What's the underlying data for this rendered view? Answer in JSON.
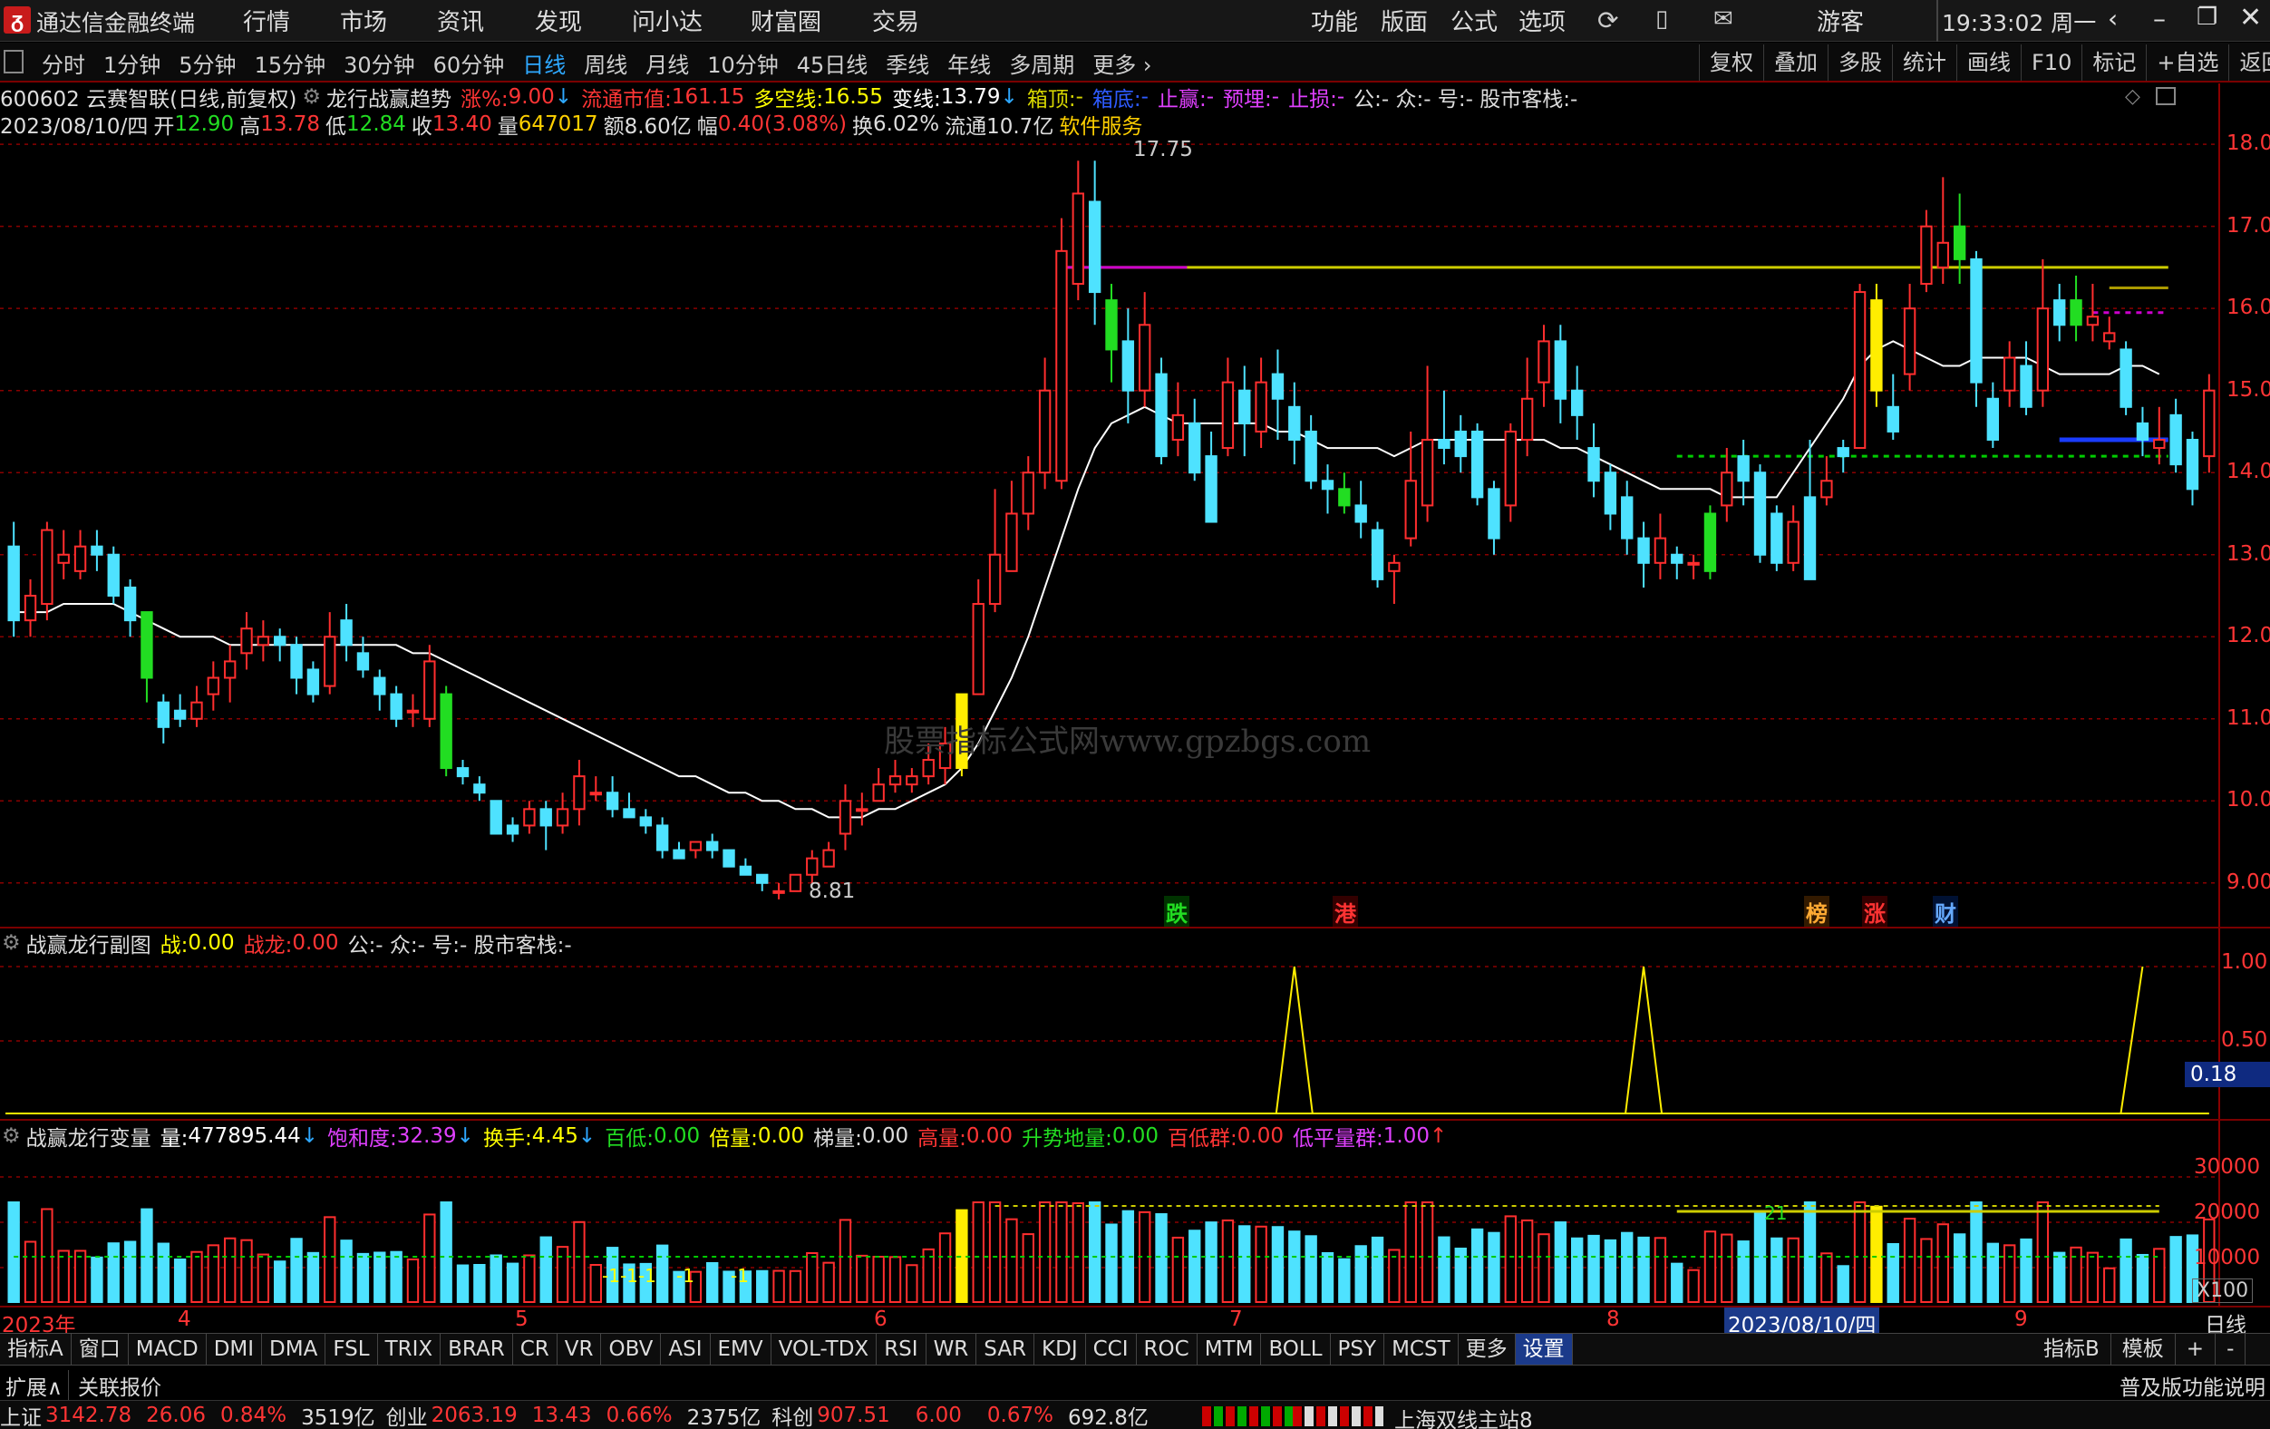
{
  "app": {
    "title": "通达信金融终端",
    "clock": "19:33:02 周一",
    "user": "游客",
    "menu": [
      "行情",
      "市场",
      "资讯",
      "发现",
      "问小达",
      "财富圈",
      "交易"
    ],
    "menu_right": [
      "功能",
      "版面",
      "公式",
      "选项"
    ]
  },
  "periods": {
    "items": [
      "分时",
      "1分钟",
      "5分钟",
      "15分钟",
      "30分钟",
      "60分钟",
      "日线",
      "周线",
      "月线",
      "10分钟",
      "45日线",
      "季线",
      "年线",
      "多周期",
      "更多"
    ],
    "active": "日线"
  },
  "toolbar": [
    "复权",
    "叠加",
    "多股",
    "统计",
    "画线",
    "F10",
    "标记",
    "+自选",
    "返回"
  ],
  "main": {
    "title": {
      "code": "600602 云赛智联(日线,前复权)",
      "indicator": "龙行战赢趋势",
      "zf_label": "涨%:",
      "zf": "9.00",
      "ltsz_label": "流通市值:",
      "ltsz": "161.15",
      "dkx_label": "多空线:",
      "dkx": "16.55",
      "bx_label": "变线:",
      "bx": "13.79",
      "xd_label": "箱顶:",
      "xd": "-",
      "xdi_label": "箱底:",
      "xdi": "-",
      "zy_label": "止赢:",
      "zy": "-",
      "ym_label": "预埋:",
      "ym": "-",
      "zs_label": "止损:",
      "zs": "-",
      "gzh": "公:- 众:- 号:- 股市客栈:-"
    },
    "ohlc": {
      "date": "2023/08/10/四",
      "open_label": "开",
      "open": "12.90",
      "high_label": "高",
      "high": "13.78",
      "low_label": "低",
      "low": "12.84",
      "close_label": "收",
      "close": "13.40",
      "vol_label": "量",
      "vol": "647017",
      "amt_label": "额",
      "amt": "8.60亿",
      "amp_label": "幅",
      "amp": "0.40(3.08%)",
      "turn_label": "换",
      "turn": "6.02%",
      "float_label": "流通",
      "float": "10.7亿",
      "service": "软件服务"
    },
    "annotations": {
      "high": "17.75",
      "low": "8.81",
      "watermark": "股票指标公式网www.gpzbgs.com"
    },
    "markers": [
      {
        "text": "跌",
        "color": "#22dd22",
        "bg": "#003300"
      },
      {
        "text": "港",
        "color": "#ff3333",
        "bg": "#330000"
      },
      {
        "text": "榜",
        "color": "#ffaa33",
        "bg": "#331a00"
      },
      {
        "text": "涨",
        "color": "#ff3333",
        "bg": "#330000"
      },
      {
        "text": "财",
        "color": "#66aaff",
        "bg": "#001133"
      }
    ],
    "y_ticks": [
      "18.00",
      "17.00",
      "16.00",
      "15.00",
      "14.00",
      "13.00",
      "12.00",
      "11.00",
      "10.00",
      "9.00"
    ]
  },
  "sub1": {
    "name": "战赢龙行副图",
    "zhan_label": "战:",
    "zhan": "0.00",
    "zhanlong_label": "战龙:",
    "zhanlong": "0.00",
    "gzh": "公:- 众:- 号:- 股市客栈:-",
    "y_ticks": [
      "1.00",
      "0.50"
    ],
    "current": "0.18"
  },
  "sub2": {
    "name": "战赢龙行变量",
    "vol_label": "量:",
    "vol": "477895.44",
    "bhd_label": "饱和度:",
    "bhd": "32.39",
    "hs_label": "换手:",
    "hs": "4.45",
    "bd_label": "百低:",
    "bd": "0.00",
    "bl_label": "倍量:",
    "bl": "0.00",
    "tl_label": "梯量:",
    "tl": "0.00",
    "gl_label": "高量:",
    "gl": "0.00",
    "ssdl_label": "升势地量:",
    "ssdl": "0.00",
    "bdq_label": "百低群:",
    "bdq": "0.00",
    "dpl_label": "低平量群:",
    "dpl": "1.00",
    "y_ticks": [
      "30000",
      "20000",
      "10000"
    ],
    "unit": "X100",
    "labels": {
      "d1": "21",
      "s1": "-1-1-1",
      "s2": "-1",
      "s3": "-1"
    }
  },
  "xaxis": {
    "labels": [
      "2023年",
      "4",
      "5",
      "6",
      "7",
      "8",
      "9"
    ],
    "cursor": "2023/08/10/四",
    "right": "日线"
  },
  "tabs": {
    "left": [
      "指标A",
      "窗口",
      "MACD",
      "DMI",
      "DMA",
      "FSL",
      "TRIX",
      "BRAR",
      "CR",
      "VR",
      "OBV",
      "ASI",
      "EMV",
      "VOL-TDX",
      "RSI",
      "WR",
      "SAR",
      "KDJ",
      "CCI",
      "ROC",
      "MTM",
      "BOLL",
      "PSY",
      "MCST",
      "更多",
      "设置"
    ],
    "right": [
      "指标B",
      "模板",
      "+",
      "-"
    ]
  },
  "bottom": {
    "left": [
      "扩展∧",
      "关联报价"
    ],
    "right": "普及版功能说明"
  },
  "status": {
    "sh_label": "上证",
    "sh": "3142.78",
    "sh_chg": "26.06",
    "sh_pct": "0.84%",
    "sh_amt": "3519亿",
    "cy_label": "创业",
    "cy": "2063.19",
    "cy_chg": "13.43",
    "cy_pct": "0.66%",
    "cy_amt": "2375亿",
    "kc_label": "科创",
    "kc": "907.51",
    "kc_chg": "6.00",
    "kc_pct": "0.67%",
    "kc_amt": "692.8亿",
    "server": "上海双线主站8"
  },
  "chart_data": {
    "type": "candlestick",
    "ylim": [
      8.6,
      18.3
    ],
    "candles": [
      [
        13.1,
        12.2,
        13.4,
        12.0
      ],
      [
        12.2,
        12.5,
        12.7,
        12.0
      ],
      [
        12.4,
        13.3,
        13.4,
        12.2
      ],
      [
        12.9,
        13.0,
        13.3,
        12.7
      ],
      [
        12.8,
        13.1,
        13.3,
        12.7
      ],
      [
        13.1,
        13.0,
        13.3,
        12.8
      ],
      [
        13.0,
        12.5,
        13.1,
        12.4
      ],
      [
        12.6,
        12.2,
        12.7,
        12.0
      ],
      [
        12.3,
        11.5,
        12.3,
        11.2
      ],
      [
        11.2,
        10.9,
        11.3,
        10.7
      ],
      [
        11.1,
        11.0,
        11.3,
        10.9
      ],
      [
        11.0,
        11.2,
        11.4,
        10.9
      ],
      [
        11.3,
        11.5,
        11.7,
        11.1
      ],
      [
        11.5,
        11.7,
        11.9,
        11.2
      ],
      [
        11.8,
        12.1,
        12.3,
        11.6
      ],
      [
        11.9,
        12.0,
        12.2,
        11.7
      ],
      [
        12.0,
        11.9,
        12.1,
        11.7
      ],
      [
        11.9,
        11.5,
        12.0,
        11.3
      ],
      [
        11.6,
        11.3,
        11.7,
        11.2
      ],
      [
        11.4,
        12.0,
        12.3,
        11.3
      ],
      [
        12.2,
        11.9,
        12.4,
        11.7
      ],
      [
        11.8,
        11.6,
        12.0,
        11.5
      ],
      [
        11.5,
        11.3,
        11.6,
        11.1
      ],
      [
        11.3,
        11.0,
        11.4,
        10.9
      ],
      [
        11.1,
        11.1,
        11.3,
        10.9
      ],
      [
        11.0,
        11.7,
        11.9,
        10.9
      ],
      [
        11.3,
        10.4,
        11.4,
        10.3
      ],
      [
        10.4,
        10.3,
        10.5,
        10.2
      ],
      [
        10.2,
        10.1,
        10.3,
        10.0
      ],
      [
        10.0,
        9.6,
        10.0,
        9.6
      ],
      [
        9.7,
        9.6,
        9.8,
        9.5
      ],
      [
        9.7,
        9.9,
        10.0,
        9.6
      ],
      [
        9.9,
        9.7,
        10.0,
        9.4
      ],
      [
        9.7,
        9.9,
        10.1,
        9.6
      ],
      [
        9.9,
        10.3,
        10.5,
        9.7
      ],
      [
        10.1,
        10.1,
        10.3,
        10.0
      ],
      [
        10.1,
        9.9,
        10.3,
        9.8
      ],
      [
        9.9,
        9.8,
        10.1,
        9.8
      ],
      [
        9.8,
        9.7,
        9.9,
        9.6
      ],
      [
        9.7,
        9.4,
        9.8,
        9.3
      ],
      [
        9.4,
        9.3,
        9.5,
        9.3
      ],
      [
        9.4,
        9.5,
        9.5,
        9.3
      ],
      [
        9.5,
        9.4,
        9.6,
        9.3
      ],
      [
        9.4,
        9.2,
        9.4,
        9.2
      ],
      [
        9.2,
        9.1,
        9.3,
        9.1
      ],
      [
        9.1,
        9.0,
        9.1,
        8.9
      ],
      [
        8.9,
        8.9,
        9.0,
        8.8
      ],
      [
        8.9,
        9.1,
        9.1,
        8.9
      ],
      [
        9.1,
        9.3,
        9.4,
        9.0
      ],
      [
        9.2,
        9.4,
        9.5,
        9.2
      ],
      [
        9.6,
        10.0,
        10.2,
        9.4
      ],
      [
        9.9,
        9.9,
        10.1,
        9.7
      ],
      [
        10.0,
        10.2,
        10.4,
        10.0
      ],
      [
        10.2,
        10.3,
        10.5,
        10.1
      ],
      [
        10.2,
        10.3,
        10.4,
        10.1
      ],
      [
        10.3,
        10.5,
        10.7,
        10.2
      ],
      [
        10.4,
        10.7,
        10.9,
        10.2
      ],
      [
        10.4,
        11.3,
        11.3,
        10.3
      ],
      [
        11.3,
        12.4,
        12.7,
        11.3
      ],
      [
        12.4,
        13.0,
        13.8,
        12.3
      ],
      [
        12.8,
        13.5,
        13.9,
        12.8
      ],
      [
        13.5,
        14.0,
        14.2,
        13.3
      ],
      [
        14.0,
        15.0,
        15.4,
        13.8
      ],
      [
        13.9,
        16.7,
        17.1,
        13.8
      ],
      [
        16.3,
        17.4,
        17.8,
        16.1
      ],
      [
        17.3,
        16.2,
        17.8,
        15.8
      ],
      [
        16.1,
        15.5,
        16.3,
        15.1
      ],
      [
        15.6,
        15.0,
        16.0,
        14.6
      ],
      [
        15.0,
        15.8,
        16.2,
        14.8
      ],
      [
        15.2,
        14.2,
        15.4,
        14.1
      ],
      [
        14.4,
        14.7,
        15.1,
        14.2
      ],
      [
        14.6,
        14.0,
        14.9,
        13.9
      ],
      [
        14.2,
        13.4,
        14.5,
        13.4
      ],
      [
        14.3,
        15.1,
        15.4,
        14.2
      ],
      [
        15.0,
        14.6,
        15.3,
        14.2
      ],
      [
        14.5,
        15.1,
        15.4,
        14.3
      ],
      [
        15.2,
        14.9,
        15.5,
        14.4
      ],
      [
        14.8,
        14.4,
        15.1,
        14.1
      ],
      [
        14.5,
        13.9,
        14.7,
        13.8
      ],
      [
        13.9,
        13.8,
        14.1,
        13.5
      ],
      [
        13.8,
        13.6,
        14.0,
        13.5
      ],
      [
        13.6,
        13.4,
        13.9,
        13.2
      ],
      [
        13.3,
        12.7,
        13.4,
        12.6
      ],
      [
        12.8,
        12.9,
        13.0,
        12.4
      ],
      [
        13.2,
        13.9,
        14.5,
        13.1
      ],
      [
        13.6,
        14.4,
        15.3,
        13.4
      ],
      [
        14.4,
        14.3,
        15.0,
        14.1
      ],
      [
        14.5,
        14.2,
        14.7,
        14.0
      ],
      [
        14.5,
        13.7,
        14.6,
        13.6
      ],
      [
        13.8,
        13.2,
        13.9,
        13.0
      ],
      [
        13.6,
        14.5,
        14.6,
        13.4
      ],
      [
        14.4,
        14.9,
        15.4,
        14.2
      ],
      [
        15.1,
        15.6,
        15.8,
        14.8
      ],
      [
        15.6,
        14.9,
        15.8,
        14.6
      ],
      [
        15.0,
        14.7,
        15.3,
        14.4
      ],
      [
        14.3,
        13.9,
        14.6,
        13.7
      ],
      [
        14.0,
        13.5,
        14.1,
        13.3
      ],
      [
        13.7,
        13.2,
        13.9,
        13.0
      ],
      [
        13.2,
        12.9,
        13.4,
        12.6
      ],
      [
        12.9,
        13.2,
        13.5,
        12.7
      ],
      [
        13.0,
        12.9,
        13.1,
        12.7
      ],
      [
        12.9,
        12.9,
        13.0,
        12.7
      ],
      [
        12.8,
        13.5,
        13.6,
        12.7
      ],
      [
        13.6,
        14.0,
        14.3,
        13.4
      ],
      [
        14.2,
        13.9,
        14.4,
        13.6
      ],
      [
        14.0,
        13.0,
        14.1,
        12.9
      ],
      [
        13.5,
        12.9,
        13.6,
        12.8
      ],
      [
        12.9,
        13.4,
        13.6,
        12.8
      ],
      [
        13.7,
        12.7,
        14.4,
        12.7
      ],
      [
        13.7,
        13.9,
        14.2,
        13.6
      ],
      [
        14.3,
        14.2,
        14.4,
        14.0
      ],
      [
        14.3,
        16.2,
        16.3,
        14.3
      ],
      [
        16.1,
        15.0,
        16.3,
        14.8
      ],
      [
        14.8,
        14.5,
        15.2,
        14.4
      ],
      [
        15.2,
        16.0,
        16.3,
        15.0
      ],
      [
        16.3,
        17.0,
        17.2,
        16.2
      ],
      [
        16.5,
        16.8,
        17.6,
        16.3
      ],
      [
        17.0,
        16.6,
        17.4,
        16.3
      ],
      [
        16.6,
        15.1,
        16.7,
        14.8
      ],
      [
        14.9,
        14.4,
        15.1,
        14.3
      ],
      [
        15.0,
        15.4,
        15.6,
        14.8
      ],
      [
        15.3,
        14.8,
        15.6,
        14.7
      ],
      [
        15.0,
        16.0,
        16.6,
        14.8
      ],
      [
        16.1,
        15.8,
        16.3,
        15.6
      ],
      [
        15.8,
        16.1,
        16.4,
        15.6
      ],
      [
        15.8,
        15.9,
        16.3,
        15.6
      ],
      [
        15.6,
        15.7,
        15.9,
        15.5
      ],
      [
        15.5,
        14.8,
        15.6,
        14.7
      ],
      [
        14.6,
        14.4,
        14.8,
        14.2
      ],
      [
        14.3,
        14.4,
        14.8,
        14.1
      ],
      [
        14.7,
        14.1,
        14.9,
        14.0
      ],
      [
        14.4,
        13.8,
        14.5,
        13.6
      ],
      [
        14.2,
        15.0,
        15.2,
        14.0
      ]
    ],
    "ma": [
      12.3,
      12.3,
      12.3,
      12.4,
      12.4,
      12.4,
      12.4,
      12.3,
      12.2,
      12.1,
      12.0,
      12.0,
      12.0,
      11.9,
      11.9,
      11.9,
      11.9,
      11.9,
      11.9,
      11.9,
      11.9,
      11.9,
      11.9,
      11.9,
      11.8,
      11.8,
      11.7,
      11.6,
      11.5,
      11.4,
      11.3,
      11.2,
      11.1,
      11.0,
      10.9,
      10.8,
      10.7,
      10.6,
      10.5,
      10.4,
      10.3,
      10.3,
      10.2,
      10.1,
      10.1,
      10.0,
      10.0,
      9.9,
      9.9,
      9.8,
      9.8,
      9.8,
      9.9,
      9.9,
      10.0,
      10.1,
      10.2,
      10.4,
      10.7,
      11.1,
      11.5,
      12.0,
      12.6,
      13.2,
      13.8,
      14.3,
      14.6,
      14.7,
      14.8,
      14.7,
      14.6,
      14.6,
      14.6,
      14.6,
      14.6,
      14.6,
      14.5,
      14.5,
      14.4,
      14.3,
      14.3,
      14.3,
      14.3,
      14.2,
      14.3,
      14.4,
      14.4,
      14.4,
      14.4,
      14.4,
      14.4,
      14.4,
      14.4,
      14.3,
      14.3,
      14.2,
      14.1,
      14.0,
      13.9,
      13.8,
      13.8,
      13.8,
      13.8,
      13.7,
      13.7,
      13.7,
      13.7,
      14.0,
      14.3,
      14.6,
      14.9,
      15.3,
      15.5,
      15.6,
      15.5,
      15.4,
      15.3,
      15.3,
      15.4,
      15.4,
      15.4,
      15.4,
      15.3,
      15.2,
      15.2,
      15.2,
      15.2,
      15.3,
      15.3,
      15.2
    ],
    "sub_peaks": [
      {
        "i": 77,
        "v": 1.0
      },
      {
        "i": 98,
        "v": 1.0
      },
      {
        "i": 128,
        "v": 1.0
      }
    ],
    "hlines": [
      {
        "y": 16.5,
        "from": 63,
        "to": 129,
        "color": "#cccc00"
      },
      {
        "y": 16.5,
        "from": 63,
        "to": 70,
        "color": "#cc00cc"
      },
      {
        "y": 14.2,
        "from": 100,
        "to": 129,
        "color": "#00cc00",
        "dash": true
      },
      {
        "y": 14.4,
        "from": 123,
        "to": 129,
        "color": "#1a3cff"
      },
      {
        "y": 16.25,
        "from": 126,
        "to": 129,
        "color": "#aa9900"
      },
      {
        "y": 15.95,
        "from": 125,
        "to": 129,
        "color": "#cc00cc",
        "dash": true
      }
    ]
  }
}
